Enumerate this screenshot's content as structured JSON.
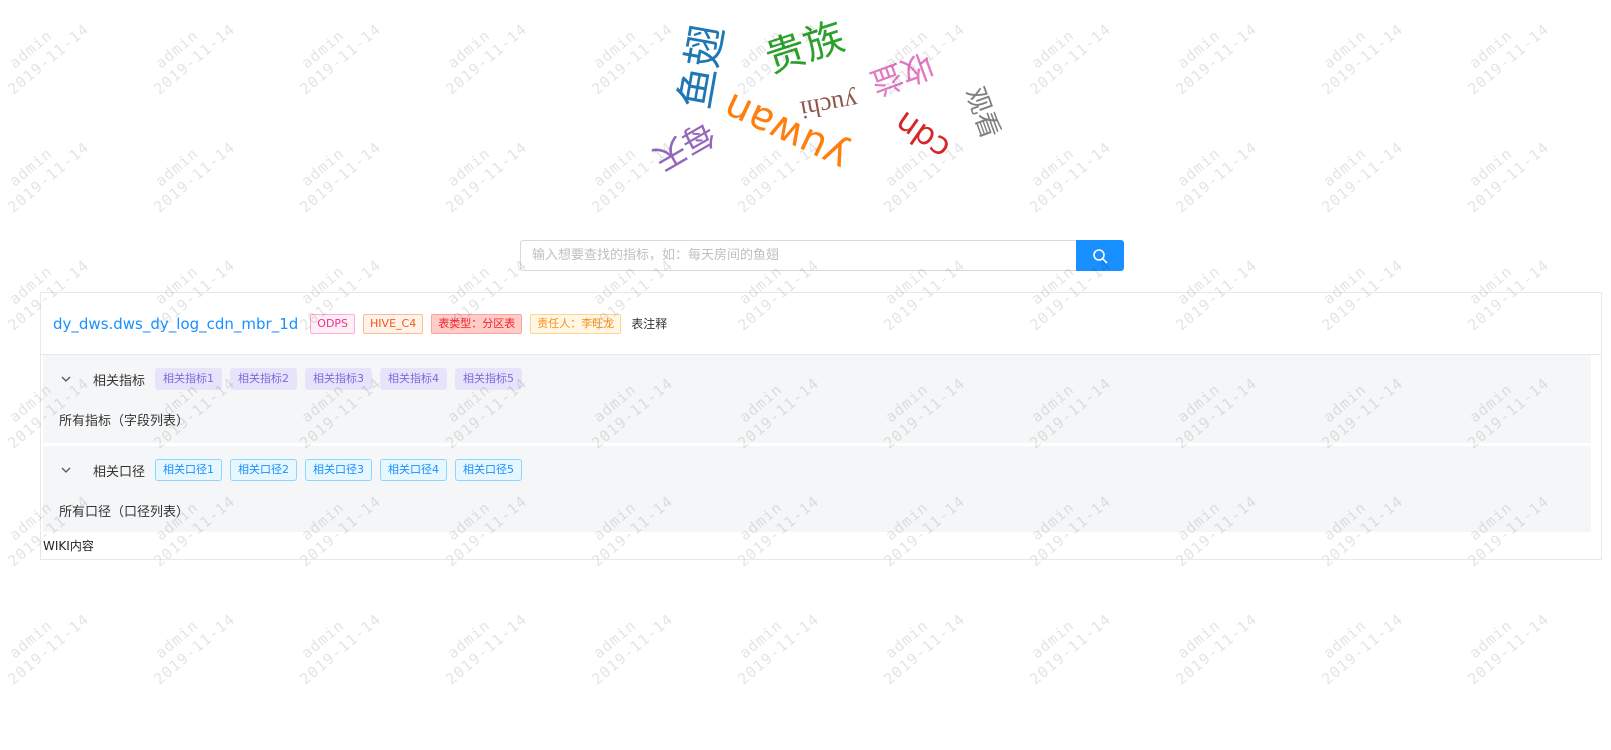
{
  "watermark": {
    "line1": "admin",
    "line2": "2019-11-14"
  },
  "word_cloud": [
    {
      "text": "鱼翅",
      "color": "#1f77b4"
    },
    {
      "text": "贵族",
      "color": "#2ca02c"
    },
    {
      "text": "收益",
      "color": "#e377c2"
    },
    {
      "text": "yuchi",
      "color": "#8c564b"
    },
    {
      "text": "观看",
      "color": "#7f7f7f"
    },
    {
      "text": "yuwan",
      "color": "#ff7f0e"
    },
    {
      "text": "cdn",
      "color": "#d62728"
    },
    {
      "text": "每天",
      "color": "#9467bd"
    }
  ],
  "search": {
    "placeholder": "输入想要查找的指标，如：每天房间的鱼翅",
    "value": ""
  },
  "result": {
    "table_name": "dy_dws.dws_dy_log_cdn_mbr_1d",
    "tags": {
      "odps": "ODPS",
      "hive": "HIVE_C4",
      "type": "表类型：分区表",
      "owner": "责任人：李旺龙"
    },
    "comment": "表注释",
    "metrics": {
      "title": "相关指标",
      "items": [
        "相关指标1",
        "相关指标2",
        "相关指标3",
        "相关指标4",
        "相关指标5"
      ],
      "body": "所有指标（字段列表）"
    },
    "calibers": {
      "title": "相关口径",
      "items": [
        "相关口径1",
        "相关口径2",
        "相关口径3",
        "相关口径4",
        "相关口径5"
      ],
      "body": "所有口径（口径列表）"
    },
    "wiki": "WIKI内容"
  },
  "colors": {
    "accent": "#1890ff"
  },
  "icons": {
    "search_button": "search-icon",
    "collapse": "chevron-down-icon"
  }
}
